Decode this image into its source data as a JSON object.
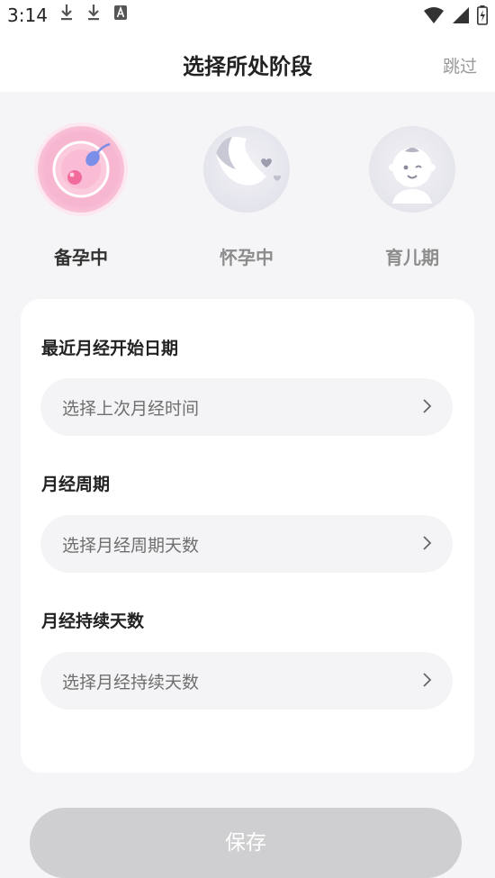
{
  "status_bar": {
    "time": "3:14"
  },
  "header": {
    "title": "选择所处阶段",
    "skip_label": "跳过"
  },
  "stages": [
    {
      "label": "备孕中",
      "active": true
    },
    {
      "label": "怀孕中",
      "active": false
    },
    {
      "label": "育儿期",
      "active": false
    }
  ],
  "form": {
    "fields": [
      {
        "label": "最近月经开始日期",
        "placeholder": "选择上次月经时间"
      },
      {
        "label": "月经周期",
        "placeholder": "选择月经周期天数"
      },
      {
        "label": "月经持续天数",
        "placeholder": "选择月经持续天数"
      }
    ]
  },
  "save_label": "保存",
  "colors": {
    "accent_pink": "#f7a9c8",
    "save_disabled": "#cfcfd1"
  }
}
